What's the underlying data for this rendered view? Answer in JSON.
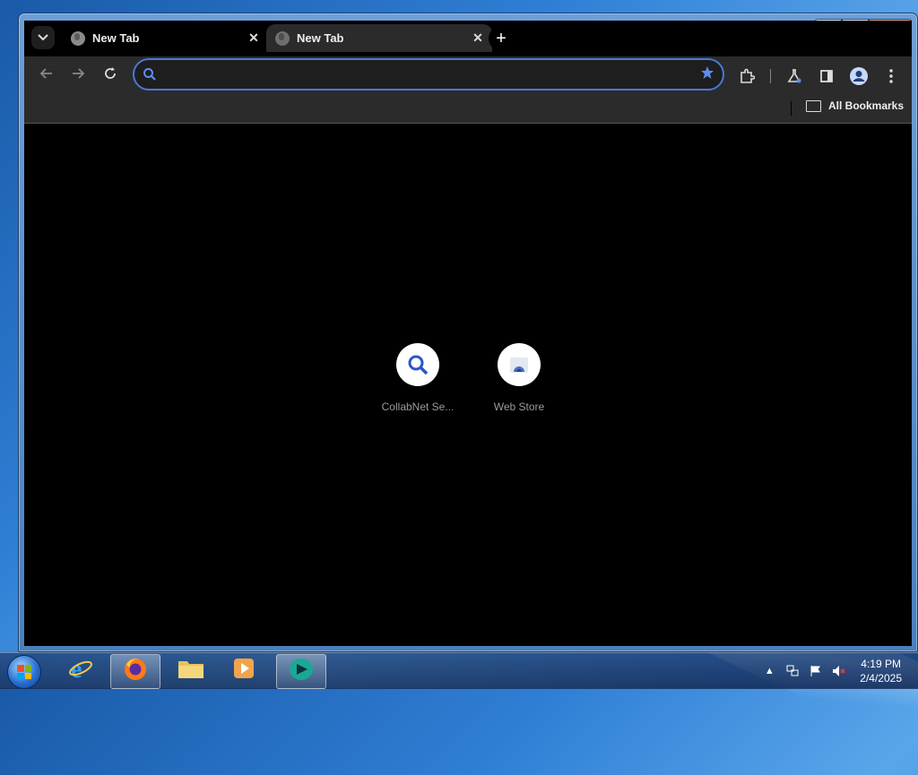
{
  "browser": {
    "tabs": [
      {
        "title": "New Tab",
        "state": "inactive"
      },
      {
        "title": "New Tab",
        "state": "active"
      }
    ],
    "tab_close_glyph": "✕",
    "new_tab_glyph": "+",
    "omnibox": {
      "value": "",
      "placeholder": ""
    },
    "bookmarks": {
      "all_bookmarks_label": "All Bookmarks"
    },
    "shortcuts": [
      {
        "label": "CollabNet Se...",
        "icon": "search-icon"
      },
      {
        "label": "Web Store",
        "icon": "webstore-icon"
      }
    ],
    "accent_color": "#4a78d8"
  },
  "window": {
    "minimize_glyph": "—",
    "maximize_glyph": "▭",
    "close_glyph": "✕"
  },
  "taskbar": {
    "apps": [
      {
        "name": "Internet Explorer",
        "icon": "ie-icon"
      },
      {
        "name": "Firefox",
        "icon": "firefox-icon"
      },
      {
        "name": "Windows Explorer",
        "icon": "folder-icon"
      },
      {
        "name": "Media Player",
        "icon": "media-player-icon"
      },
      {
        "name": "Browser",
        "icon": "browser-icon"
      }
    ],
    "clock": {
      "time": "4:19 PM",
      "date": "2/4/2025"
    }
  }
}
